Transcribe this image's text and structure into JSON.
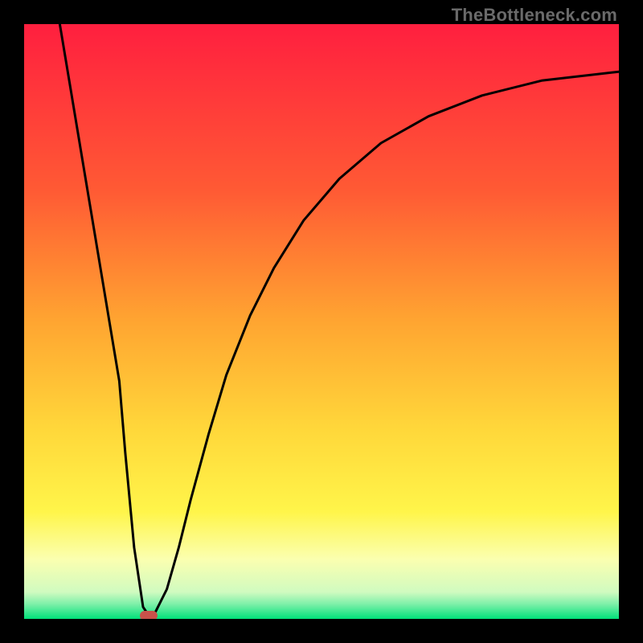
{
  "watermark": {
    "text": "TheBottleneck.com"
  },
  "chart_data": {
    "type": "line",
    "title": "",
    "xlabel": "",
    "ylabel": "",
    "xlim": [
      0,
      100
    ],
    "ylim": [
      0,
      100
    ],
    "grid": false,
    "legend": false,
    "background_gradient_stops": [
      {
        "pos": 0.0,
        "color": "#ff1f3f"
      },
      {
        "pos": 0.28,
        "color": "#ff5a34"
      },
      {
        "pos": 0.5,
        "color": "#ffa531"
      },
      {
        "pos": 0.68,
        "color": "#ffd73a"
      },
      {
        "pos": 0.82,
        "color": "#fff54a"
      },
      {
        "pos": 0.9,
        "color": "#fbffb0"
      },
      {
        "pos": 0.955,
        "color": "#d0fbc0"
      },
      {
        "pos": 0.975,
        "color": "#7ef0a9"
      },
      {
        "pos": 1.0,
        "color": "#00e079"
      }
    ],
    "series": [
      {
        "name": "bottleneck-curve",
        "x": [
          6,
          8,
          10,
          12,
          14,
          16,
          17,
          18.5,
          20,
          21,
          22,
          24,
          26,
          28,
          31,
          34,
          38,
          42,
          47,
          53,
          60,
          68,
          77,
          87,
          100
        ],
        "y": [
          100,
          88,
          76,
          64,
          52,
          40,
          28,
          12,
          2,
          0.5,
          1,
          5,
          12,
          20,
          31,
          41,
          51,
          59,
          67,
          74,
          80,
          84.5,
          88,
          90.5,
          92
        ],
        "note": "y is bottleneck % — plotted inverted (0 at bottom = green, 100 at top = red)"
      }
    ],
    "marker": {
      "x": 21,
      "y": 0.5,
      "color": "#c9524a"
    }
  }
}
